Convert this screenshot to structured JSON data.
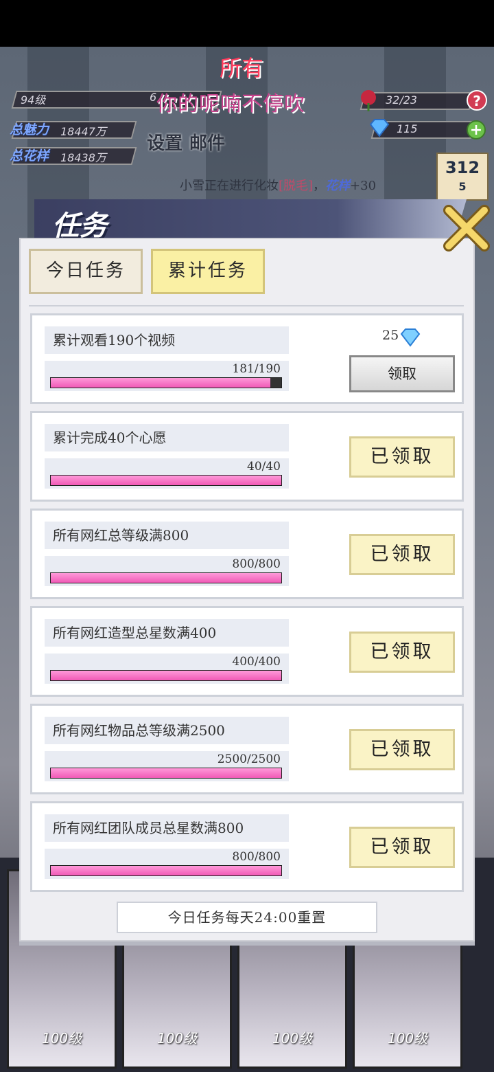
{
  "hud": {
    "level": "94级",
    "exp_partial": "6",
    "roses": "32/23",
    "gems": "115",
    "charm_label": "总魅力",
    "charm_value": "18447万",
    "pattern_label": "总花样",
    "pattern_value": "18438万",
    "settings_label": "设置",
    "mail_label": "邮件",
    "rank_value": "5"
  },
  "marquee": {
    "line1": "所有",
    "line2": "你的呢喃不停吹"
  },
  "news": {
    "prefix": "小雪正在进行化妆",
    "bracket_item": "[脱毛]",
    "stat_label": "花样",
    "stat_value": "+30"
  },
  "panel": {
    "title": "任务",
    "tabs": [
      {
        "label": "今日任务",
        "active": false
      },
      {
        "label": "累计任务",
        "active": true
      }
    ],
    "footer_note": "今日任务每天24:00重置"
  },
  "tasks": [
    {
      "name": "累计观看190个视频",
      "progress_text": "181/190",
      "progress": 0.953,
      "status": "claim",
      "button_label": "领取",
      "reward_amount": "25"
    },
    {
      "name": "累计完成40个心愿",
      "progress_text": "40/40",
      "progress": 1.0,
      "status": "claimed",
      "button_label": "已领取"
    },
    {
      "name": "所有网红总等级满800",
      "progress_text": "800/800",
      "progress": 1.0,
      "status": "claimed",
      "button_label": "已领取"
    },
    {
      "name": "所有网红造型总星数满400",
      "progress_text": "400/400",
      "progress": 1.0,
      "status": "claimed",
      "button_label": "已领取"
    },
    {
      "name": "所有网红物品总等级满2500",
      "progress_text": "2500/2500",
      "progress": 1.0,
      "status": "claimed",
      "button_label": "已领取"
    },
    {
      "name": "所有网红团队成员总星数满800",
      "progress_text": "800/800",
      "progress": 1.0,
      "status": "claimed",
      "button_label": "已领取"
    }
  ],
  "characters": [
    {
      "level": "100级"
    },
    {
      "level": "100级"
    },
    {
      "level": "100级"
    },
    {
      "level": "100级"
    }
  ],
  "colors": {
    "progress_fill": "#f15ab6",
    "tab_active": "#faf0a4",
    "claimed_button": "#faf3c6"
  }
}
